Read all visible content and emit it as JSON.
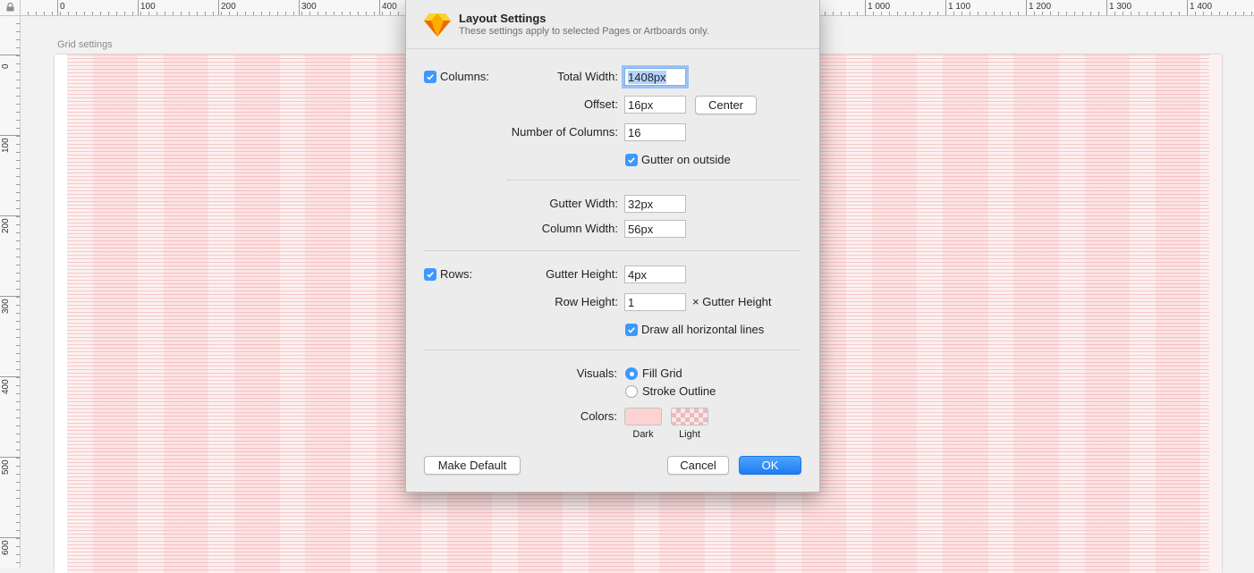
{
  "canvas": {
    "artboard_label": "Grid settings",
    "ruler_top_labels": [
      "0",
      "100",
      "200",
      "300",
      "400",
      "1 000",
      "1 100",
      "1 200",
      "1 300",
      "1 400"
    ],
    "ruler_left_labels": [
      "0",
      "100",
      "200",
      "300",
      "400",
      "500",
      "600"
    ],
    "grid_color": "#fde3e3"
  },
  "dialog": {
    "title": "Layout Settings",
    "subtitle": "These settings apply to selected Pages or Artboards only.",
    "columns": {
      "enabled": true,
      "label": "Columns:",
      "total_width_label": "Total Width:",
      "total_width_value": "1408px",
      "offset_label": "Offset:",
      "offset_value": "16px",
      "center_button": "Center",
      "number_label": "Number of Columns:",
      "number_value": "16",
      "gutter_outside_checked": true,
      "gutter_outside_label": "Gutter on outside",
      "gutter_width_label": "Gutter Width:",
      "gutter_width_value": "32px",
      "column_width_label": "Column Width:",
      "column_width_value": "56px"
    },
    "rows": {
      "enabled": true,
      "label": "Rows:",
      "gutter_height_label": "Gutter Height:",
      "gutter_height_value": "4px",
      "row_height_label": "Row Height:",
      "row_height_value": "1",
      "row_height_suffix": "× Gutter Height",
      "draw_all_checked": true,
      "draw_all_label": "Draw all horizontal lines"
    },
    "visuals": {
      "label": "Visuals:",
      "options": [
        "Fill Grid",
        "Stroke Outline"
      ],
      "selected": "Fill Grid"
    },
    "colors": {
      "label": "Colors:",
      "dark_label": "Dark",
      "light_label": "Light",
      "dark_color": "#fbd3d3",
      "light_color": "#fbe6e6"
    },
    "buttons": {
      "make_default": "Make Default",
      "cancel": "Cancel",
      "ok": "OK"
    },
    "accent_color": "#3b99fc"
  }
}
